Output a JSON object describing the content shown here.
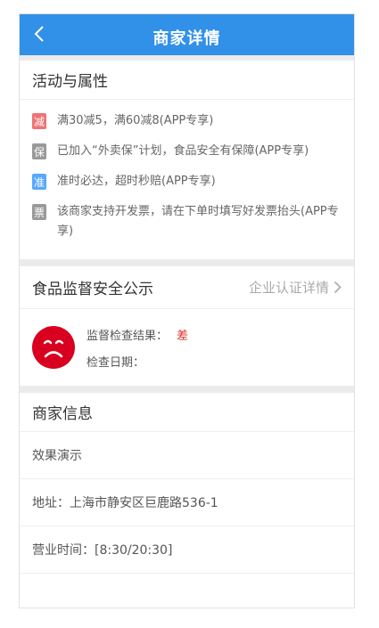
{
  "header": {
    "title": "商家详情",
    "back_icon": "chevron-left-icon"
  },
  "activities": {
    "title": "活动与属性",
    "items": [
      {
        "badge": "减",
        "color": "#f07373",
        "text": "满30减5，满60减8(APP专享)"
      },
      {
        "badge": "保",
        "color": "#999999",
        "text": "已加入“外卖保”计划，食品安全有保障(APP专享)"
      },
      {
        "badge": "准",
        "color": "#57a9ff",
        "text": "准时必达，超时秒赔(APP专享)"
      },
      {
        "badge": "票",
        "color": "#999999",
        "text": "该商家支持开发票，请在下单时填写好发票抬头(APP专享)"
      }
    ]
  },
  "food_safety": {
    "title": "食品监督安全公示",
    "link_label": "企业认证详情",
    "face_icon": "sad-face-icon",
    "face_color": "#d8001e",
    "result_label": "监督检查结果：",
    "result_value": "差",
    "result_color": "#e02e24",
    "date_label": "检查日期："
  },
  "merchant": {
    "title": "商家信息",
    "rows": [
      "效果演示",
      "地址：上海市静安区巨鹿路536-1",
      "营业时间：[8:30/20:30]"
    ]
  },
  "colors": {
    "primary": "#3190e8",
    "divider": "#ebebeb"
  }
}
